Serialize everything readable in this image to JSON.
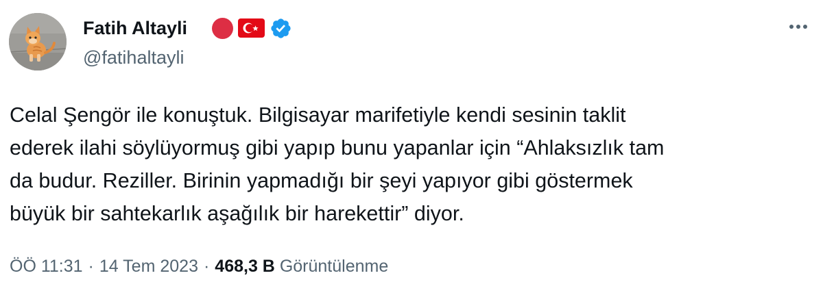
{
  "author": {
    "name": "Fatih Altayli",
    "handle": "@fatihaltayli",
    "avatar_icon": "cat-avatar-icon",
    "badges": [
      "red-circle-icon",
      "turkish-flag-icon",
      "verified-badge-icon"
    ]
  },
  "tweet": {
    "text": "Celal Şengör ile konuştuk. Bilgisayar marifetiyle kendi sesinin taklit\nederek ilahi söylüyormuş gibi yapıp bunu yapanlar için “Ahlaksızlık tam\nda budur.  Reziller. Birinin yapmadığı bir şeyi yapıyor gibi göstermek\nbüyük bir sahtekarlık aşağılık bir harekettir” diyor.",
    "time": "ÖÖ 11:31",
    "separator": "·",
    "date": "14 Tem 2023",
    "views_count": "468,3 B",
    "views_label": "Görüntülenme"
  },
  "menu": {
    "more_icon": "more-options-icon"
  },
  "colors": {
    "text_primary": "#0f1419",
    "text_secondary": "#536471",
    "verified_blue": "#1d9bf0",
    "red_circle": "#dd2e44",
    "flag_red": "#e30a17"
  }
}
